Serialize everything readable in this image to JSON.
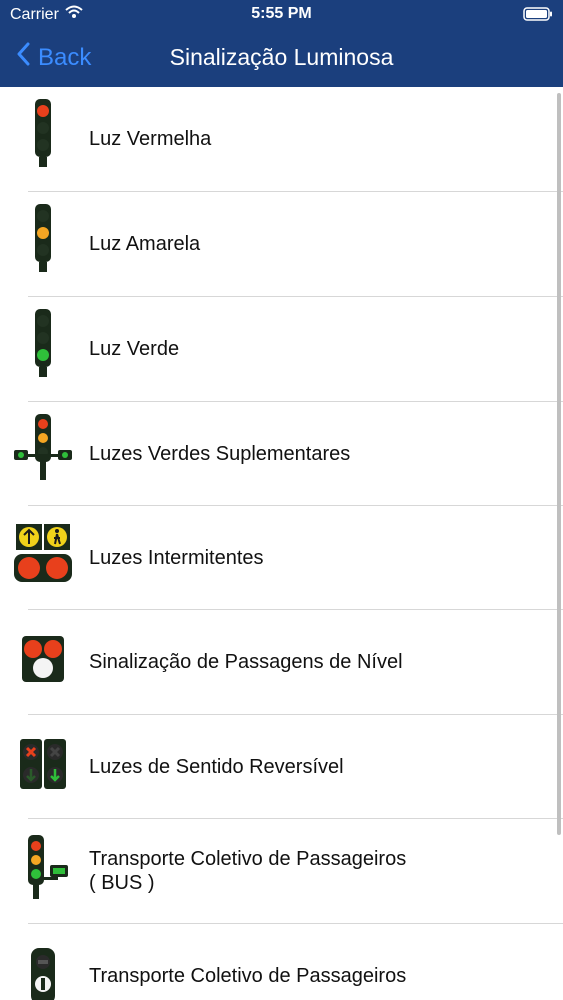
{
  "status_bar": {
    "carrier": "Carrier",
    "time": "5:55 PM"
  },
  "nav": {
    "back_label": "Back",
    "title": "Sinalização Luminosa"
  },
  "items": [
    {
      "label": "Luz Vermelha",
      "icon": "red-traffic-light-icon"
    },
    {
      "label": "Luz Amarela",
      "icon": "yellow-traffic-light-icon"
    },
    {
      "label": "Luz Verde",
      "icon": "green-traffic-light-icon"
    },
    {
      "label": "Luzes Verdes Suplementares",
      "icon": "supplementary-green-lights-icon"
    },
    {
      "label": "Luzes Intermitentes",
      "icon": "flashing-lights-icon"
    },
    {
      "label": "Sinalização de Passagens de Nível",
      "icon": "level-crossing-signal-icon"
    },
    {
      "label": "Luzes de Sentido Reversível",
      "icon": "reversible-lane-lights-icon"
    },
    {
      "label": "Transporte Coletivo de Passageiros ( BUS )",
      "line1": "Transporte Coletivo de Passageiros",
      "line2": "( BUS )",
      "icon": "bus-traffic-light-icon"
    },
    {
      "label": "Transporte Coletivo de Passageiros",
      "icon": "public-transport-signal-icon"
    }
  ],
  "colors": {
    "navbar": "#1b3f7d",
    "back_accent": "#3b8cff",
    "red_light": "#e8401c",
    "amber_light": "#f5a623",
    "green_light": "#2fbf3a"
  }
}
